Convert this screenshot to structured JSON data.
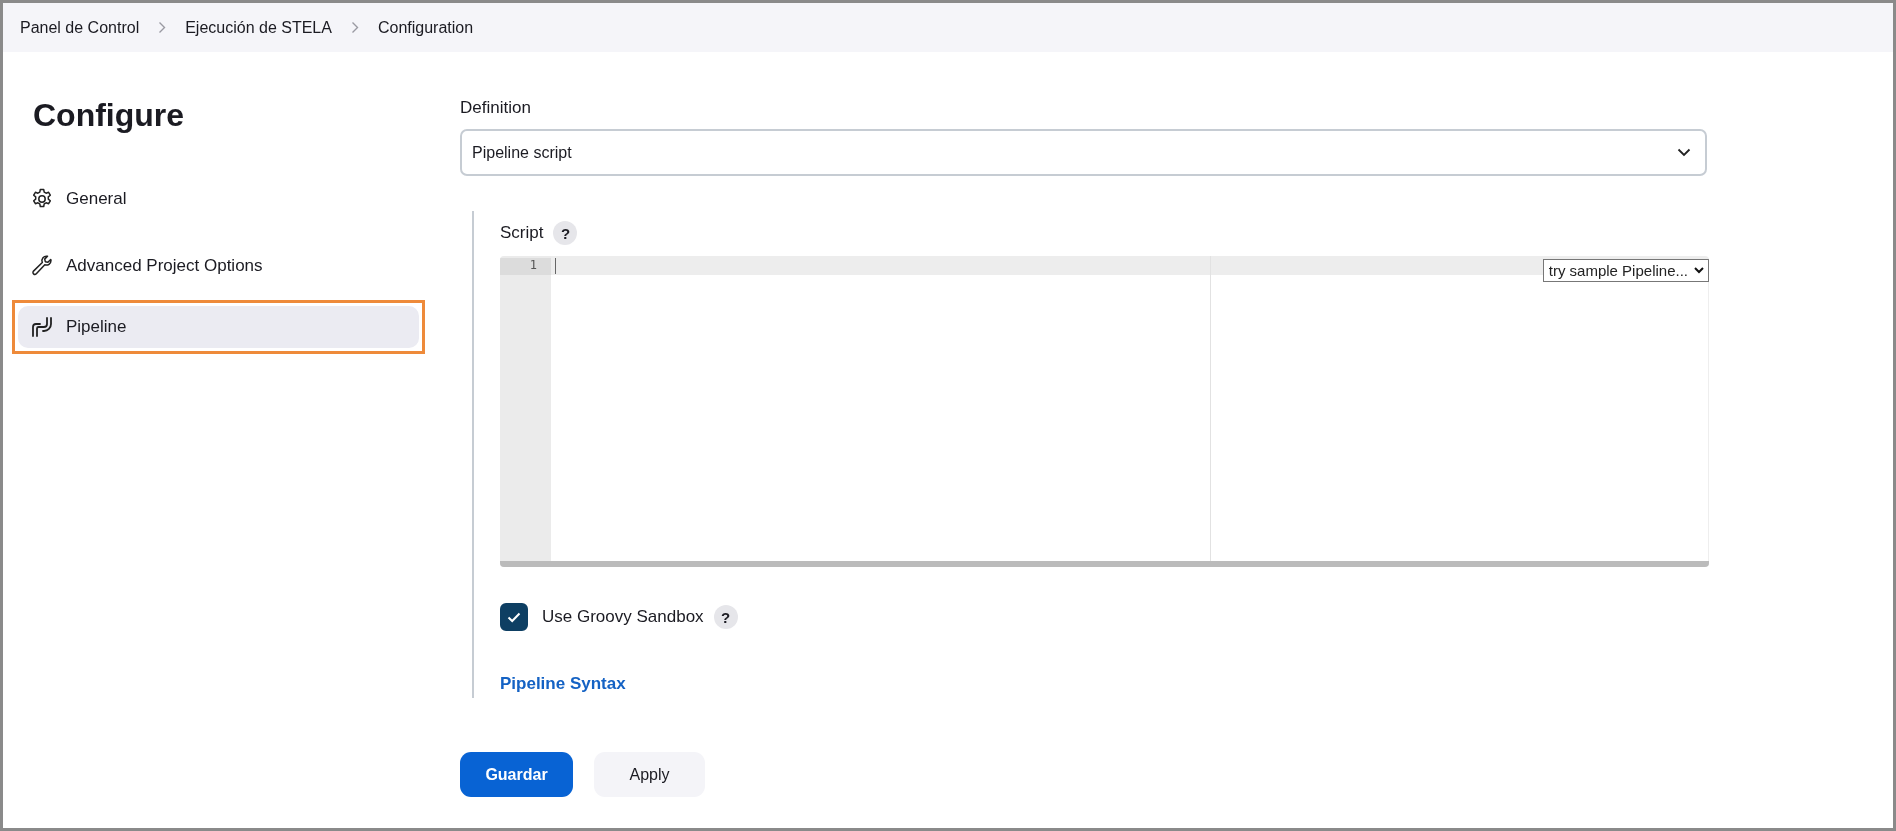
{
  "breadcrumbs": [
    {
      "label": "Panel de Control"
    },
    {
      "label": "Ejecución de STELA"
    },
    {
      "label": "Configuration"
    }
  ],
  "sidebar": {
    "title": "Configure",
    "items": [
      {
        "kind": "gear",
        "label": "General",
        "selected": false
      },
      {
        "kind": "wrench",
        "label": "Advanced Project Options",
        "selected": false
      },
      {
        "kind": "pipeline",
        "label": "Pipeline",
        "selected": true
      }
    ]
  },
  "definition": {
    "label": "Definition",
    "value": "Pipeline script"
  },
  "script": {
    "label": "Script",
    "help": "?",
    "line_numbers": [
      "1"
    ],
    "sample_select": "try sample Pipeline..."
  },
  "sandbox": {
    "label": "Use Groovy Sandbox",
    "checked": true,
    "help": "?"
  },
  "syntax_link": "Pipeline Syntax",
  "buttons": [
    {
      "label": "Guardar",
      "kind": "primary"
    },
    {
      "label": "Apply",
      "kind": "secondary"
    }
  ]
}
